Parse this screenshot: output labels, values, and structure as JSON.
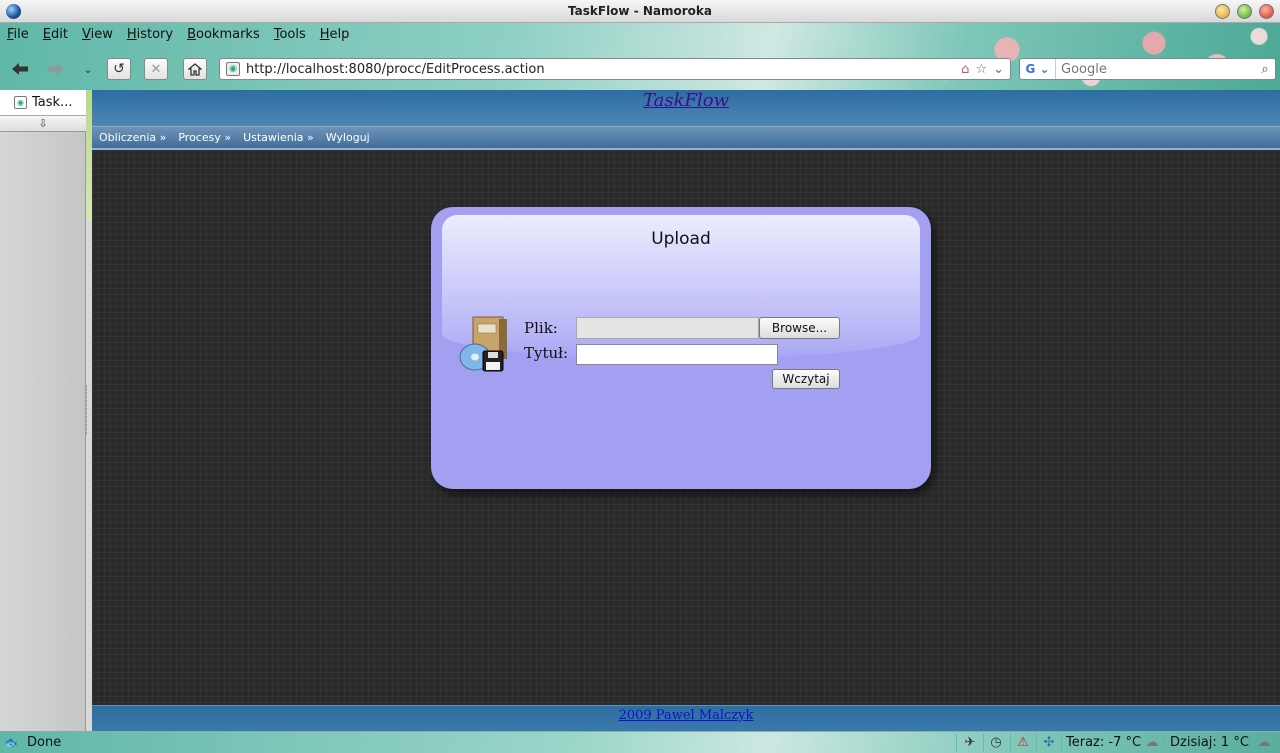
{
  "window": {
    "title": "TaskFlow - Namoroka"
  },
  "menubar": [
    {
      "label": "File",
      "accel": "F",
      "rest": "ile"
    },
    {
      "label": "Edit",
      "accel": "E",
      "rest": "dit"
    },
    {
      "label": "View",
      "accel": "V",
      "rest": "iew"
    },
    {
      "label": "History",
      "accel": "H",
      "rest": "istory"
    },
    {
      "label": "Bookmarks",
      "accel": "B",
      "rest": "ookmarks"
    },
    {
      "label": "Tools",
      "accel": "T",
      "rest": "ools"
    },
    {
      "label": "Help",
      "accel": "H",
      "rest": "elp"
    }
  ],
  "toolbar": {
    "back_icon": "arrow-left-icon",
    "forward_icon": "arrow-right-icon",
    "reload_icon": "reload-icon",
    "stop_icon": "stop-icon",
    "home_icon": "home-icon",
    "url": "http://localhost:8080/procc/EditProcess.action",
    "search_placeholder": "Google"
  },
  "tabs": [
    {
      "label": "Task..."
    }
  ],
  "page": {
    "site_title": "TaskFlow",
    "nav": [
      "Obliczenia »",
      "Procesy »",
      "Ustawienia »",
      "Wyloguj"
    ],
    "upload": {
      "title": "Upload",
      "file_label": "Plik:",
      "browse_label": "Browse...",
      "title_label": "Tytuł:",
      "title_value": "",
      "submit_label": "Wczytaj"
    },
    "footer": "2009 Pawel Malczyk"
  },
  "statusbar": {
    "status": "Done",
    "weather_now": "Teraz: -7 °C",
    "weather_today": "Dzisiaj: 1 °C"
  }
}
